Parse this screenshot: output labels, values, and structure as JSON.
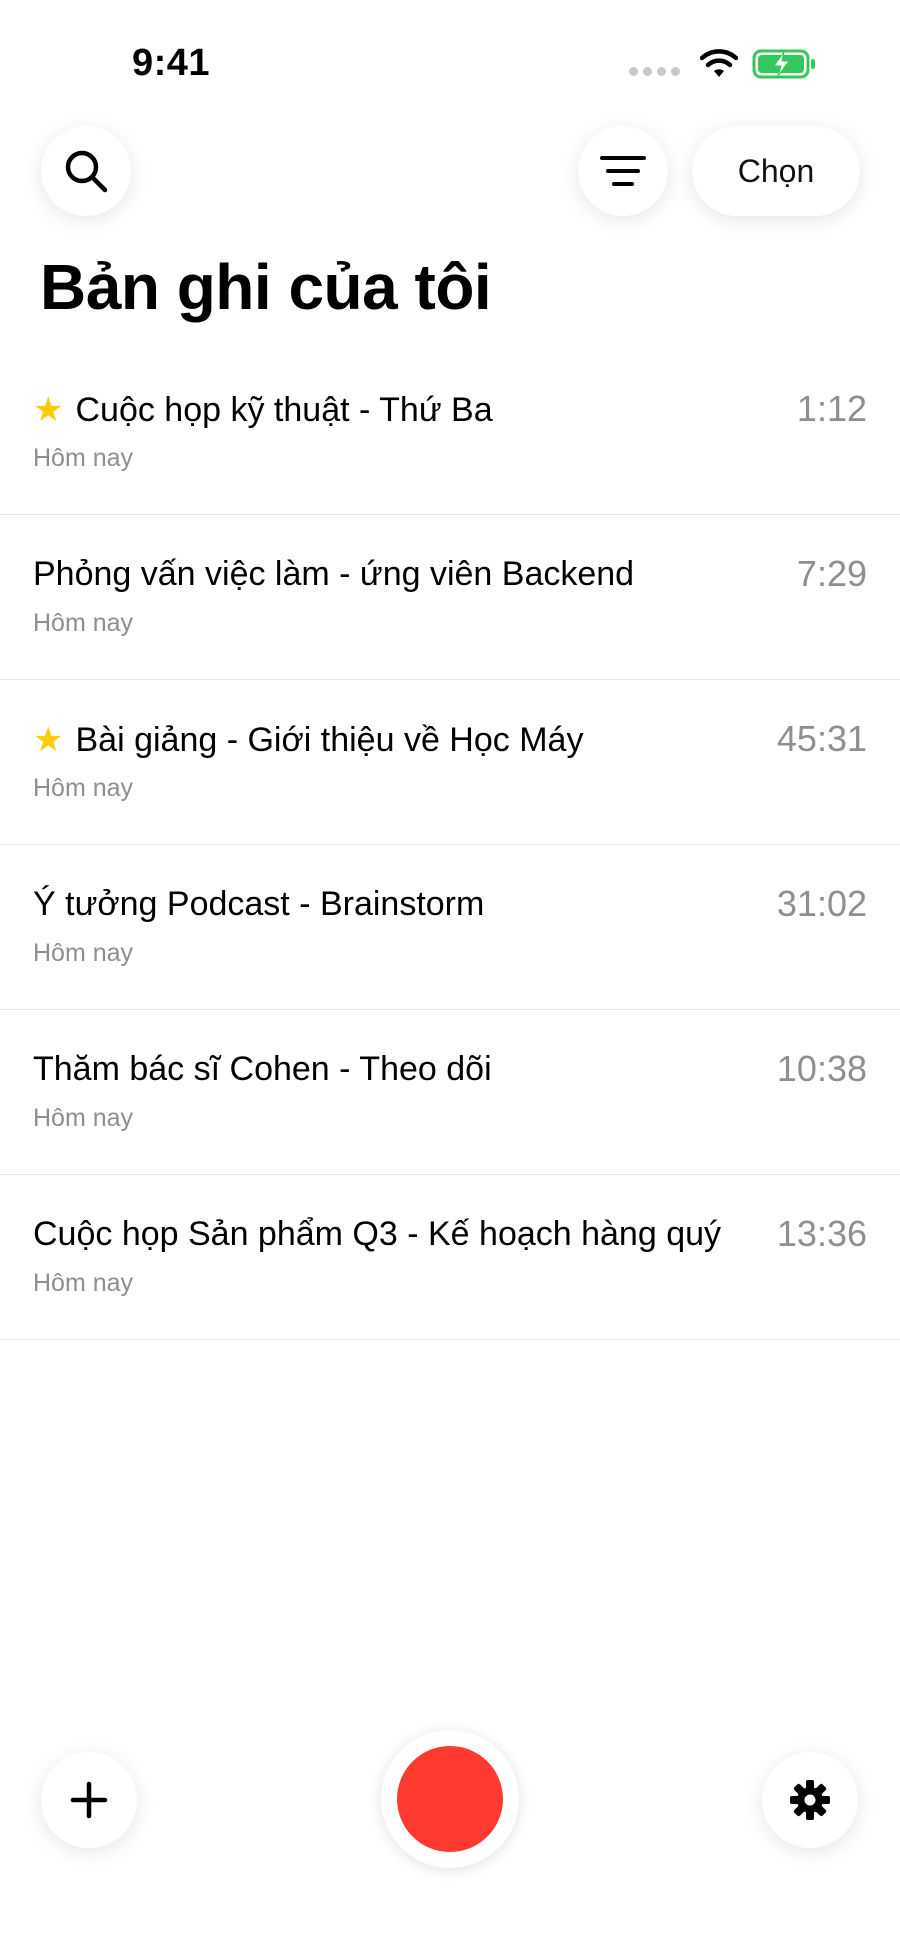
{
  "status_bar": {
    "time": "9:41"
  },
  "header": {
    "choose_label": "Chọn",
    "title": "Bản ghi của tôi"
  },
  "recordings": [
    {
      "title": "Cuộc họp kỹ thuật - Thứ Ba",
      "date": "Hôm nay",
      "duration": "1:12",
      "starred": true
    },
    {
      "title": "Phỏng vấn việc làm - ứng viên Backend",
      "date": "Hôm nay",
      "duration": "7:29",
      "starred": false
    },
    {
      "title": "Bài giảng - Giới thiệu về Học Máy",
      "date": "Hôm nay",
      "duration": "45:31",
      "starred": true
    },
    {
      "title": "Ý tưởng Podcast - Brainstorm",
      "date": "Hôm nay",
      "duration": "31:02",
      "starred": false
    },
    {
      "title": "Thăm bác sĩ Cohen - Theo dõi",
      "date": "Hôm nay",
      "duration": "10:38",
      "starred": false
    },
    {
      "title": "Cuộc họp Sản phẩm Q3 - Kế hoạch hàng quý",
      "date": "Hôm nay",
      "duration": "13:36",
      "starred": false
    }
  ],
  "icons": {
    "search": "search-icon",
    "filter": "filter-icon",
    "star": "star-icon",
    "add": "plus-icon",
    "record": "record-icon",
    "settings": "gear-icon"
  },
  "colors": {
    "record": "#ff3b30",
    "star": "#ffcc00",
    "battery": "#34c759",
    "secondary_text": "#8e8e93"
  }
}
